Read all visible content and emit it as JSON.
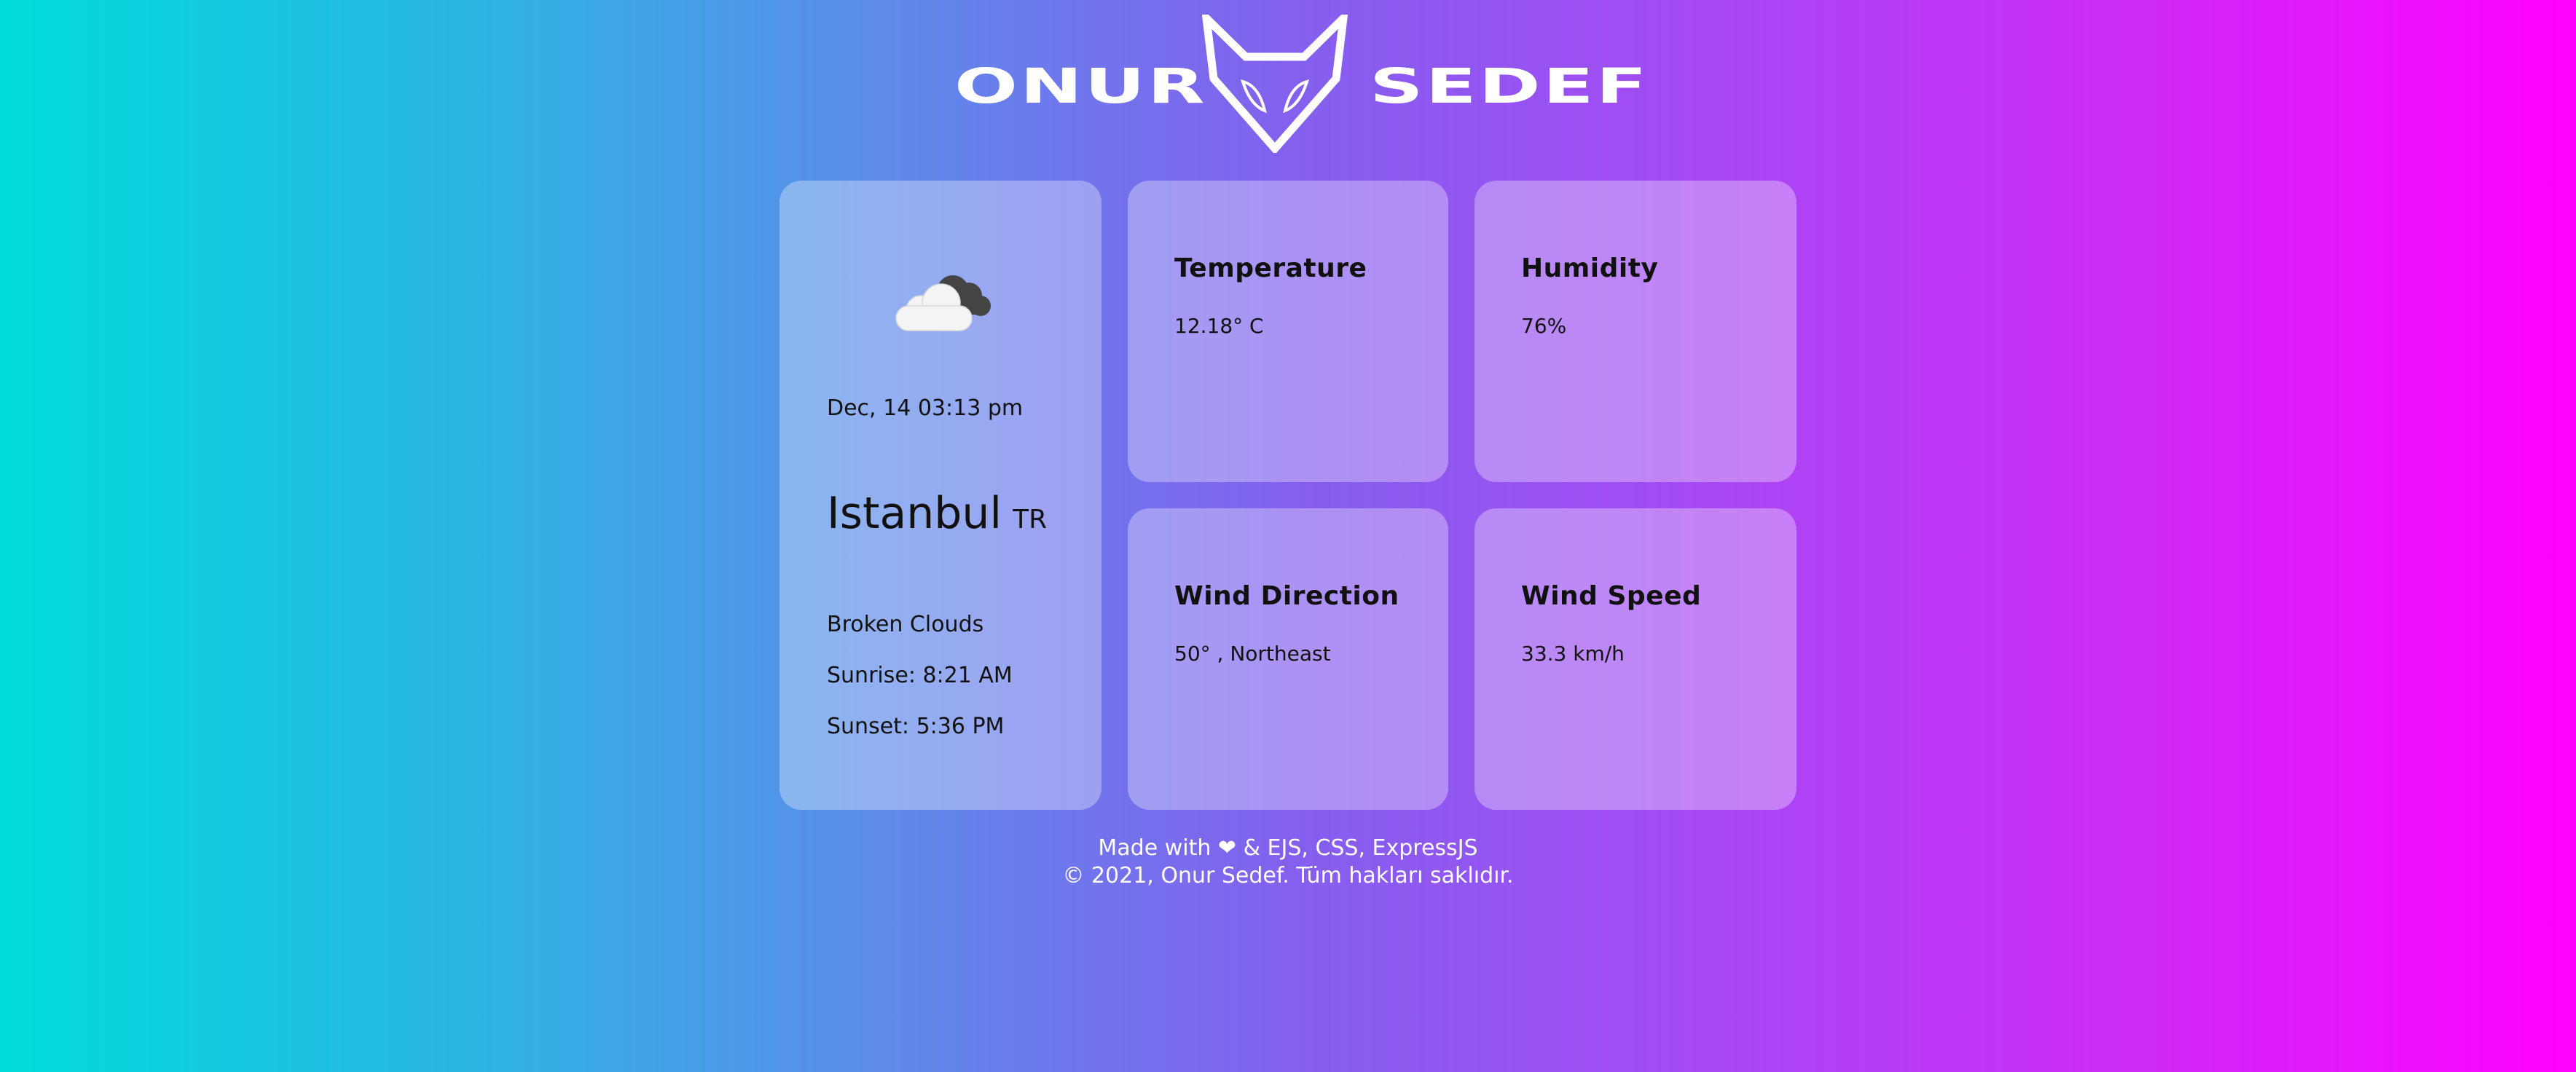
{
  "header": {
    "brand_left": "ONUR",
    "brand_right": "SEDEF",
    "logo_icon": "fox-head-logo-icon"
  },
  "weather": {
    "icon": "broken-clouds-icon",
    "date_time": "Dec, 14 03:13 pm",
    "city": "Istanbul",
    "country": "TR",
    "condition": "Broken Clouds",
    "sunrise": "Sunrise: 8:21 AM",
    "sunset": "Sunset: 5:36 PM"
  },
  "tiles": {
    "temperature": {
      "title": "Temperature",
      "value": "12.18° C"
    },
    "humidity": {
      "title": "Humidity",
      "value": "76%"
    },
    "wind_direction": {
      "title": "Wind Direction",
      "value": "50° , Northeast"
    },
    "wind_speed": {
      "title": "Wind Speed",
      "value": "33.3 km/h"
    }
  },
  "footer": {
    "made_with_prefix": "Made with",
    "made_with_suffix": "& EJS, CSS, ExpressJS",
    "heart_icon": "heart-icon",
    "copyright": "© 2021, Onur Sedef. Tüm hakları saklıdır."
  },
  "colors": {
    "gradient_start": "#00dcdc",
    "gradient_mid": "#8360ee",
    "gradient_end": "#ff00ff",
    "card_overlay": "rgba(255,255,255,0.32)"
  }
}
